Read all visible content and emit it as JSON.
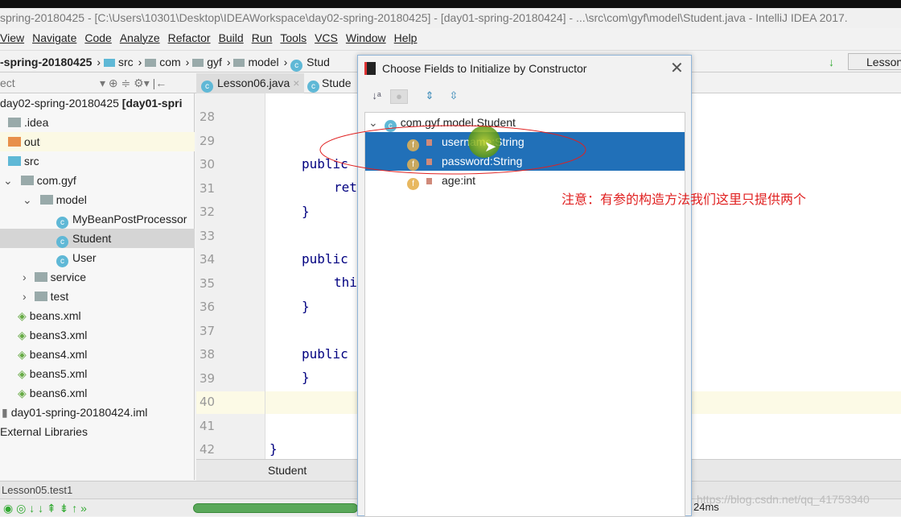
{
  "window_title": "spring-20180425 - [C:\\Users\\10301\\Desktop\\IDEAWorkspace\\day02-spring-20180425] - [day01-spring-20180424] - ...\\src\\com\\gyf\\model\\Student.java - IntelliJ IDEA 2017.",
  "menu": [
    "View",
    "Navigate",
    "Code",
    "Analyze",
    "Refactor",
    "Build",
    "Run",
    "Tools",
    "VCS",
    "Window",
    "Help"
  ],
  "breadcrumb": [
    "-spring-20180425",
    "src",
    "com",
    "gyf",
    "model",
    "Stud"
  ],
  "run_config": "Lesson",
  "project_panel": {
    "label": "ect"
  },
  "tabs": [
    "Lesson06.java",
    "Stude"
  ],
  "tree": [
    {
      "label": "day02-spring-20180425",
      "bold": "[day01-spri"
    },
    {
      "label": ".idea"
    },
    {
      "label": "out"
    },
    {
      "label": "src"
    },
    {
      "label": "com.gyf"
    },
    {
      "label": "model"
    },
    {
      "label": "MyBeanPostProcessor"
    },
    {
      "label": "Student"
    },
    {
      "label": "User"
    },
    {
      "label": "service"
    },
    {
      "label": "test"
    },
    {
      "label": "beans.xml"
    },
    {
      "label": "beans3.xml"
    },
    {
      "label": "beans4.xml"
    },
    {
      "label": "beans5.xml"
    },
    {
      "label": "beans6.xml"
    },
    {
      "label": "day01-spring-20180424.iml"
    },
    {
      "label": "External Libraries"
    }
  ],
  "line_numbers": [
    "28",
    "29",
    "30",
    "31",
    "32",
    "33",
    "34",
    "35",
    "36",
    "37",
    "38",
    "39",
    "40",
    "41",
    "42"
  ],
  "code": {
    "l29": "public",
    "l30": "ret",
    "l31": "}",
    "l33": "public",
    "l34": "thi",
    "l35": "}",
    "l37": "public",
    "l38": "}",
    "l41": "}"
  },
  "editor_bottom_tab": "Student",
  "run_tab": "Lesson05.test1",
  "run_time": "24ms",
  "dialog": {
    "title": "Choose Fields to Initialize by Constructor",
    "root": "com.gyf.model.Student",
    "fields": [
      {
        "name": "username:String",
        "selected": true
      },
      {
        "name": "password:String",
        "selected": true
      },
      {
        "name": "age:int",
        "selected": false
      }
    ]
  },
  "annotation": "注意：有参的构造方法我们这里只提供两个",
  "watermark": "https://blog.csdn.net/qq_41753340",
  "colors": {
    "selection": "#2170b8",
    "annotation": "#e02020",
    "current_line": "#fcfae6"
  }
}
